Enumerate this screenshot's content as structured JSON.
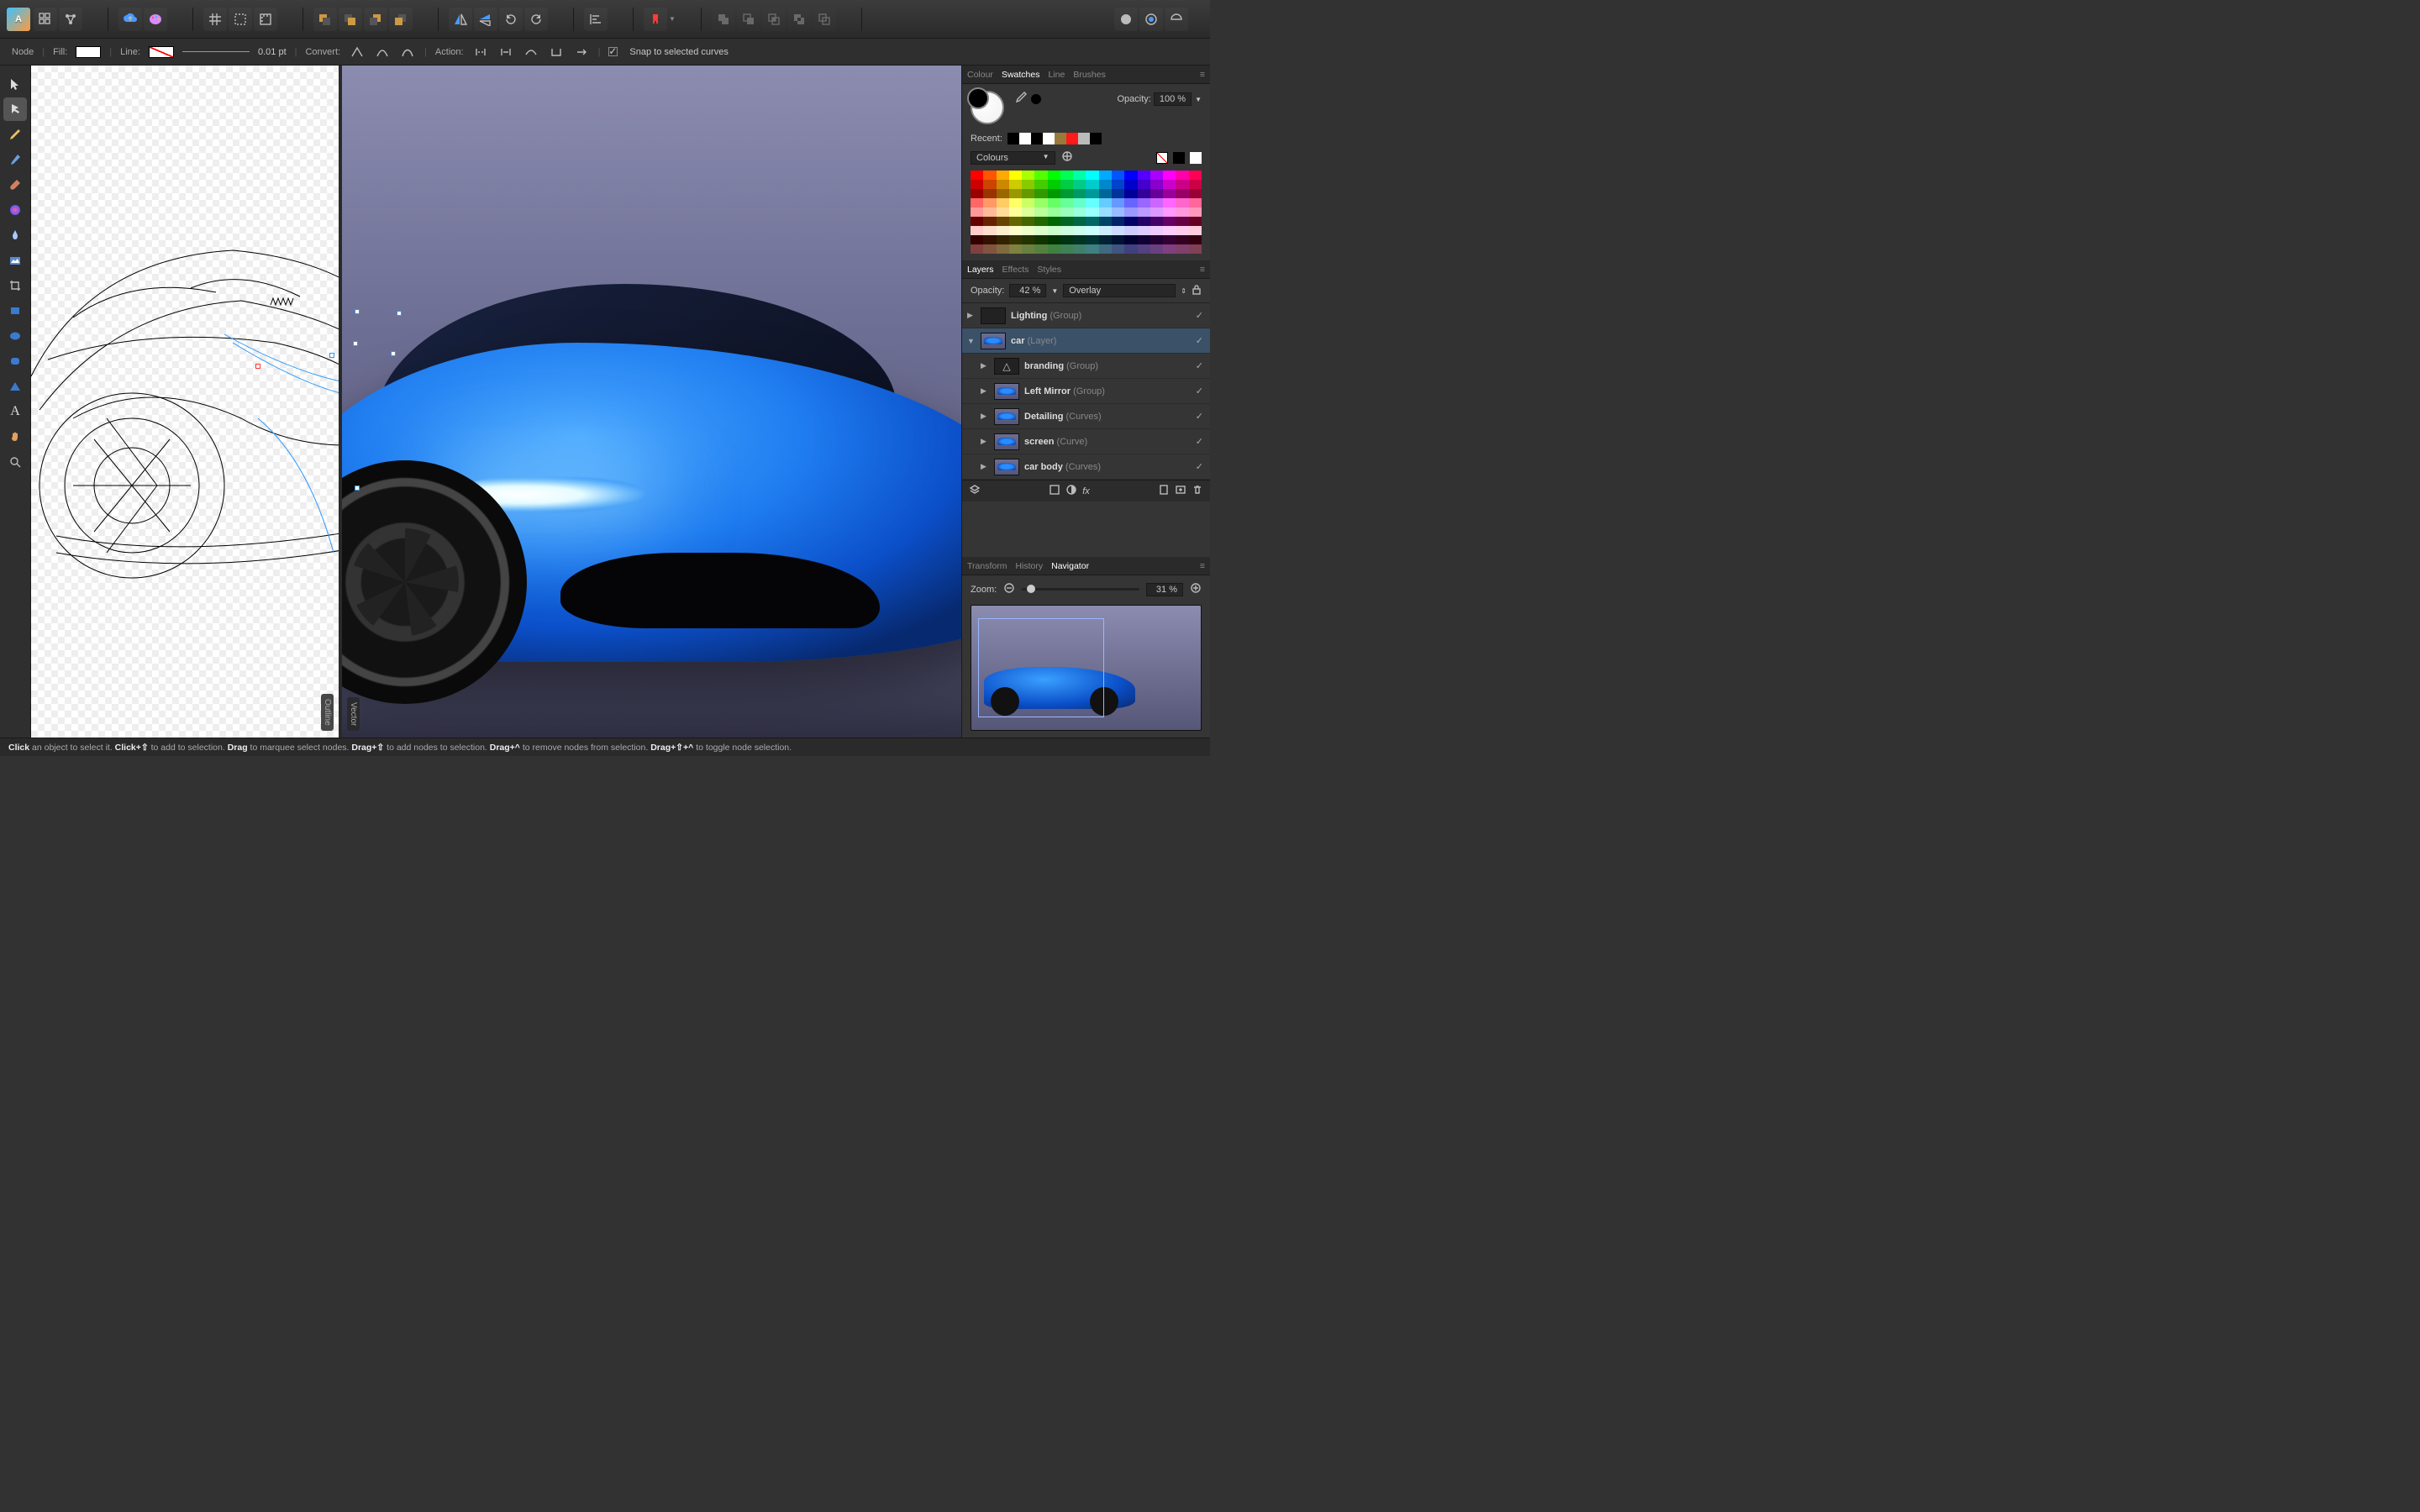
{
  "context": {
    "mode": "Node",
    "fill_label": "Fill:",
    "line_label": "Line:",
    "line_weight": "0.01 pt",
    "convert_label": "Convert:",
    "action_label": "Action:",
    "snap_label": "Snap to selected curves"
  },
  "split": {
    "left": "Outline",
    "right": "Vector"
  },
  "swatches": {
    "tabs": [
      "Colour",
      "Swatches",
      "Line",
      "Brushes"
    ],
    "active_tab": 1,
    "opacity_label": "Opacity:",
    "opacity_value": "100 %",
    "recent_label": "Recent:",
    "recent_colors": [
      "#000000",
      "#ffffff",
      "#000000",
      "#ffffff",
      "#9a7a3a",
      "#ff1a1a",
      "#bbbbbb",
      "#000000"
    ],
    "preset_label": "Colours",
    "none_swatch": true
  },
  "layers": {
    "tabs": [
      "Layers",
      "Effects",
      "Styles"
    ],
    "active_tab": 0,
    "opacity_label": "Opacity:",
    "opacity_value": "42 %",
    "blend_mode": "Overlay",
    "items": [
      {
        "name": "Lighting",
        "type": "(Group)",
        "selected": false,
        "child": false,
        "expand": "▶"
      },
      {
        "name": "car",
        "type": "(Layer)",
        "selected": true,
        "child": false,
        "expand": "▼"
      },
      {
        "name": "branding",
        "type": "(Group)",
        "selected": false,
        "child": true,
        "expand": "▶"
      },
      {
        "name": "Left Mirror",
        "type": "(Group)",
        "selected": false,
        "child": true,
        "expand": "▶"
      },
      {
        "name": "Detailing",
        "type": "(Curves)",
        "selected": false,
        "child": true,
        "expand": "▶"
      },
      {
        "name": "screen",
        "type": "(Curve)",
        "selected": false,
        "child": true,
        "expand": "▶"
      },
      {
        "name": "car body",
        "type": "(Curves)",
        "selected": false,
        "child": true,
        "expand": "▶"
      }
    ]
  },
  "navigator": {
    "tabs": [
      "Transform",
      "History",
      "Navigator"
    ],
    "active_tab": 2,
    "zoom_label": "Zoom:",
    "zoom_value": "31 %"
  },
  "status": {
    "parts": [
      {
        "b": "Click",
        "t": " an object to select it. "
      },
      {
        "b": "Click+⇧",
        "t": " to add to selection. "
      },
      {
        "b": "Drag",
        "t": " to marquee select nodes. "
      },
      {
        "b": "Drag+⇧",
        "t": " to add nodes to selection. "
      },
      {
        "b": "Drag+^",
        "t": " to remove nodes from selection. "
      },
      {
        "b": "Drag+⇧+^",
        "t": " to toggle node selection."
      }
    ]
  },
  "swatch_grid_colors": [
    "#ff0000",
    "#ff5500",
    "#ffaa00",
    "#ffff00",
    "#aaff00",
    "#55ff00",
    "#00ff00",
    "#00ff55",
    "#00ffaa",
    "#00ffff",
    "#00aaff",
    "#0055ff",
    "#0000ff",
    "#5500ff",
    "#aa00ff",
    "#ff00ff",
    "#ff00aa",
    "#ff0055",
    "#cc0000",
    "#cc4400",
    "#cc8800",
    "#cccc00",
    "#88cc00",
    "#44cc00",
    "#00cc00",
    "#00cc44",
    "#00cc88",
    "#00cccc",
    "#0088cc",
    "#0044cc",
    "#0000cc",
    "#4400cc",
    "#8800cc",
    "#cc00cc",
    "#cc0088",
    "#cc0044",
    "#990000",
    "#993300",
    "#996600",
    "#999900",
    "#669900",
    "#339900",
    "#009900",
    "#009933",
    "#009966",
    "#009999",
    "#006699",
    "#003399",
    "#000099",
    "#330099",
    "#660099",
    "#990099",
    "#990066",
    "#990033",
    "#ff6666",
    "#ff9966",
    "#ffcc66",
    "#ffff66",
    "#ccff66",
    "#99ff66",
    "#66ff66",
    "#66ff99",
    "#66ffcc",
    "#66ffff",
    "#66ccff",
    "#6699ff",
    "#6666ff",
    "#9966ff",
    "#cc66ff",
    "#ff66ff",
    "#ff66cc",
    "#ff6699",
    "#ff9999",
    "#ffbb99",
    "#ffdd99",
    "#ffff99",
    "#ddff99",
    "#bbff99",
    "#99ff99",
    "#99ffbb",
    "#99ffdd",
    "#99ffff",
    "#99ddff",
    "#99bbff",
    "#9999ff",
    "#bb99ff",
    "#dd99ff",
    "#ff99ff",
    "#ff99dd",
    "#ff99bb",
    "#660000",
    "#662200",
    "#664400",
    "#666600",
    "#446600",
    "#226600",
    "#006600",
    "#006622",
    "#006644",
    "#006666",
    "#004466",
    "#002266",
    "#000066",
    "#220066",
    "#440066",
    "#660066",
    "#660044",
    "#660022",
    "#ffcccc",
    "#ffddcc",
    "#ffeecc",
    "#ffffcc",
    "#eeffcc",
    "#ddffcc",
    "#ccffcc",
    "#ccffdd",
    "#ccffee",
    "#ccffff",
    "#cceeff",
    "#ccddff",
    "#ccccff",
    "#ddccff",
    "#eeccff",
    "#ffccff",
    "#ffccee",
    "#ffccdd",
    "#330000",
    "#331100",
    "#332200",
    "#333300",
    "#223300",
    "#113300",
    "#003300",
    "#003311",
    "#003322",
    "#003333",
    "#002233",
    "#001133",
    "#000033",
    "#110033",
    "#220033",
    "#330033",
    "#330022",
    "#330011",
    "#804040",
    "#805540",
    "#806a40",
    "#808040",
    "#6a8040",
    "#558040",
    "#408040",
    "#408055",
    "#40806a",
    "#408080",
    "#406a80",
    "#405580",
    "#404080",
    "#554080",
    "#6a4080",
    "#804080",
    "#80406a",
    "#804055"
  ]
}
